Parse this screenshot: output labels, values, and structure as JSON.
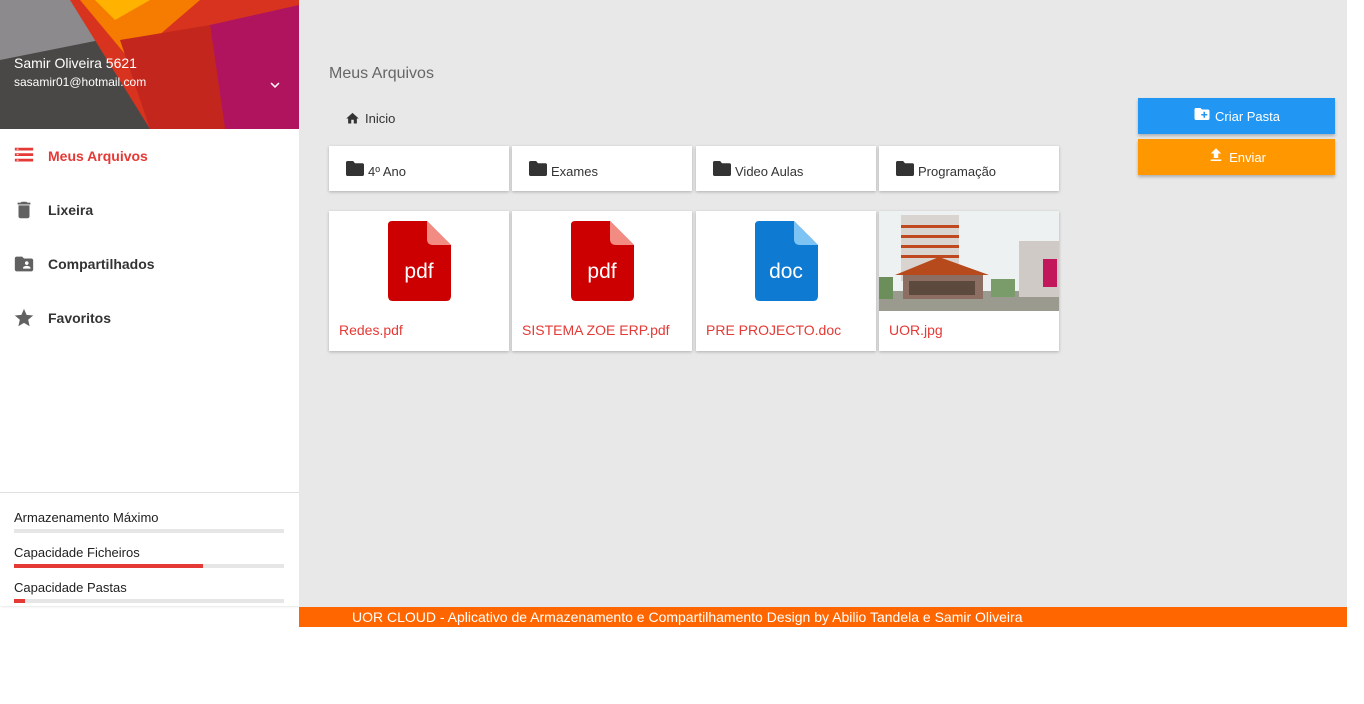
{
  "profile": {
    "name": "Samir Oliveira 5621",
    "email": "sasamir01@hotmail.com"
  },
  "nav": [
    {
      "label": "Meus Arquivos",
      "icon": "list-icon",
      "active": true
    },
    {
      "label": "Lixeira",
      "icon": "trash-icon",
      "active": false
    },
    {
      "label": "Compartilhados",
      "icon": "shared-folder-icon",
      "active": false
    },
    {
      "label": "Favoritos",
      "icon": "star-icon",
      "active": false
    }
  ],
  "storage": [
    {
      "label": "Armazenamento Máximo",
      "fill": 0
    },
    {
      "label": "Capacidade Ficheiros",
      "fill": 0.7
    },
    {
      "label": "Capacidade Pastas",
      "fill": 0.04
    }
  ],
  "main": {
    "title": "Meus Arquivos",
    "breadcrumb": "Inicio"
  },
  "folders": [
    {
      "name": "4º Ano"
    },
    {
      "name": "Exames"
    },
    {
      "name": "Video Aulas"
    },
    {
      "name": "Programação"
    }
  ],
  "files": [
    {
      "name": "Redes.pdf",
      "type": "pdf",
      "badge": "pdf"
    },
    {
      "name": "SISTEMA ZOE ERP.pdf",
      "type": "pdf",
      "badge": "pdf"
    },
    {
      "name": "PRE PROJECTO.doc",
      "type": "doc",
      "badge": "doc"
    },
    {
      "name": "UOR.jpg",
      "type": "image",
      "badge": ""
    }
  ],
  "actions": {
    "create_folder": "Criar Pasta",
    "upload": "Enviar"
  },
  "footer": "UOR CLOUD - Aplicativo de Armazenamento e Compartilhamento Design by Abilio Tandela e Samir Oliveira",
  "colors": {
    "accent": "#e53935",
    "pdf": "#cc0000",
    "doc": "#0f7ad1",
    "create_button": "#2196f3",
    "upload_button": "#ff9800",
    "footer": "#ff6600"
  }
}
